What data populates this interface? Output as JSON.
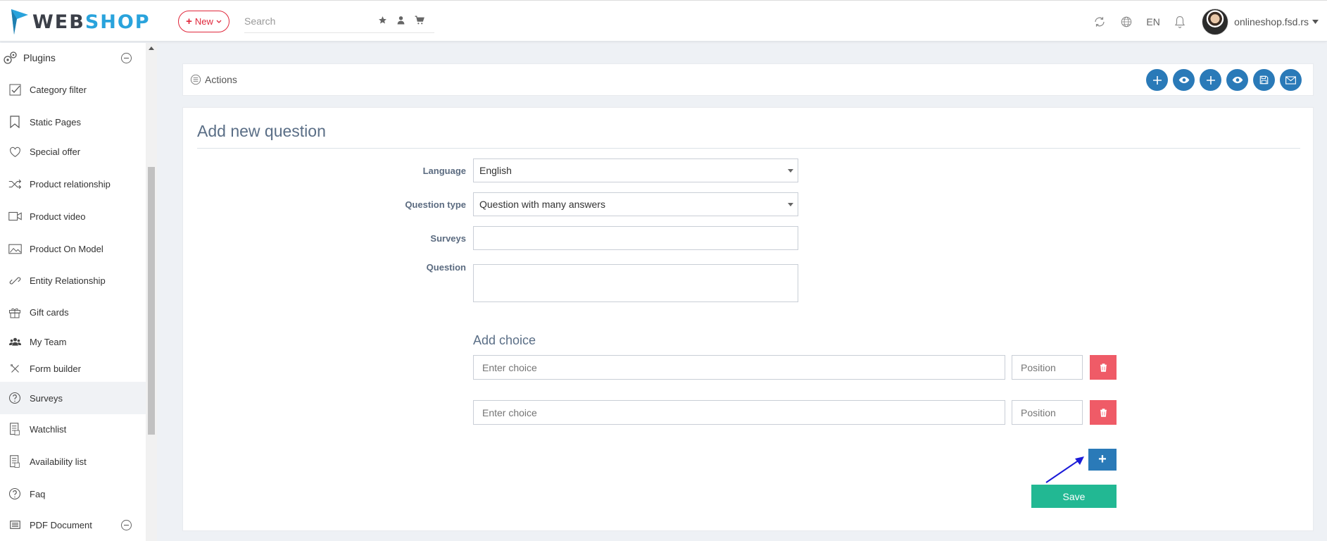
{
  "header": {
    "logo_web": "WEB",
    "logo_shop": "SHOP",
    "new_label": "New",
    "search_placeholder": "Search",
    "lang": "EN",
    "user": "onlineshop.fsd.rs"
  },
  "sidebar": {
    "section": "Plugins",
    "items": [
      {
        "label": "Category filter",
        "icon": "checkbox-icon"
      },
      {
        "label": "Static Pages",
        "icon": "bookmark-icon"
      },
      {
        "label": "Special offer",
        "icon": "heart-icon"
      },
      {
        "label": "Product relationship",
        "icon": "shuffle-icon"
      },
      {
        "label": "Product video",
        "icon": "video-icon"
      },
      {
        "label": "Product On Model",
        "icon": "image-icon"
      },
      {
        "label": "Entity Relationship",
        "icon": "link-icon"
      },
      {
        "label": "Gift cards",
        "icon": "gift-icon"
      },
      {
        "label": "My Team",
        "icon": "team-icon"
      },
      {
        "label": "Form builder",
        "icon": "tools-icon"
      },
      {
        "label": "Surveys",
        "icon": "question-icon"
      },
      {
        "label": "Watchlist",
        "icon": "list-icon"
      },
      {
        "label": "Availability list",
        "icon": "list-icon"
      },
      {
        "label": "Faq",
        "icon": "question-icon"
      },
      {
        "label": "PDF Document",
        "icon": "document-icon"
      }
    ]
  },
  "actions": {
    "label": "Actions"
  },
  "form": {
    "title": "Add new question",
    "language_label": "Language",
    "language_value": "English",
    "question_type_label": "Question type",
    "question_type_value": "Question with many answers",
    "surveys_label": "Surveys",
    "question_label": "Question",
    "add_choice_title": "Add choice",
    "choice_placeholder": "Enter choice",
    "position_placeholder": "Position",
    "add_label": "+",
    "save_label": "Save"
  },
  "colors": {
    "primary": "#2a7ab8",
    "danger": "#ef5b67",
    "success": "#22b893",
    "accent_red": "#e0283c"
  }
}
